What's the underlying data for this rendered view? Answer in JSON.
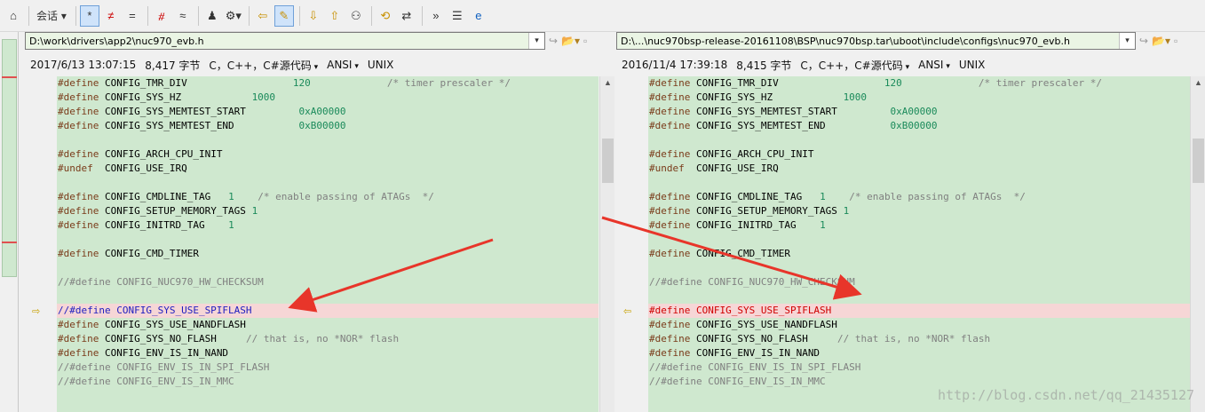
{
  "toolbar": {
    "session_label": "会话",
    "buttons": [
      "home-icon",
      "session-menu",
      "show-all-icon",
      "not-equal-icon",
      "equal-icon",
      "diff-icon",
      "approx-icon",
      "person-icon",
      "rules-icon",
      "prev-arrow-icon",
      "edit-icon",
      "down-arrow-icon",
      "up-arrow-icon",
      "binoculars-icon",
      "swap-icon",
      "refresh-icon",
      "ignore-icon",
      "list-icon",
      "ie-icon"
    ]
  },
  "left": {
    "path": "D:\\work\\drivers\\app2\\nuc970_evb.h",
    "info": {
      "date": "2017/6/13 13:07:15",
      "size": "8,417 字节",
      "lang": "C，C++，C#源代码",
      "encoding": "ANSI",
      "eol": "UNIX"
    },
    "lines": [
      {
        "kw": "#define",
        "id": "CONFIG_TMR_DIV",
        "pad1": "                 ",
        "val": "120",
        "pad2": "            ",
        "cm": "/* timer prescaler */"
      },
      {
        "kw": "#define",
        "id": "CONFIG_SYS_HZ",
        "pad1": "           ",
        "val": "1000",
        "pad2": "",
        "cm": ""
      },
      {
        "kw": "#define",
        "id": "CONFIG_SYS_MEMTEST_START",
        "pad1": "        ",
        "val": "0xA00000",
        "pad2": "",
        "cm": ""
      },
      {
        "kw": "#define",
        "id": "CONFIG_SYS_MEMTEST_END",
        "pad1": "          ",
        "val": "0xB00000",
        "pad2": "",
        "cm": ""
      },
      {
        "kw": "",
        "id": "",
        "pad1": "",
        "val": "",
        "pad2": "",
        "cm": ""
      },
      {
        "kw": "#define",
        "id": "CONFIG_ARCH_CPU_INIT",
        "pad1": "",
        "val": "",
        "pad2": "",
        "cm": ""
      },
      {
        "kw": "#undef ",
        "id": "CONFIG_USE_IRQ",
        "pad1": "",
        "val": "",
        "pad2": "",
        "cm": ""
      },
      {
        "kw": "",
        "id": "",
        "pad1": "",
        "val": "",
        "pad2": "",
        "cm": ""
      },
      {
        "kw": "#define",
        "id": "CONFIG_CMDLINE_TAG",
        "pad1": "  ",
        "val": "1",
        "pad2": "   ",
        "cm": "/* enable passing of ATAGs  */"
      },
      {
        "kw": "#define",
        "id": "CONFIG_SETUP_MEMORY_TAGS",
        "pad1": "",
        "val": "1",
        "pad2": "",
        "cm": ""
      },
      {
        "kw": "#define",
        "id": "CONFIG_INITRD_TAG",
        "pad1": "   ",
        "val": "1",
        "pad2": "",
        "cm": ""
      },
      {
        "kw": "",
        "id": "",
        "pad1": "",
        "val": "",
        "pad2": "",
        "cm": ""
      },
      {
        "kw": "#define",
        "id": "CONFIG_CMD_TIMER",
        "pad1": "",
        "val": "",
        "pad2": "",
        "cm": ""
      },
      {
        "kw": "",
        "id": "",
        "pad1": "",
        "val": "",
        "pad2": "",
        "cm": ""
      },
      {
        "kw": "",
        "id": "",
        "pad1": "",
        "val": "",
        "pad2": "",
        "cm": "//#define CONFIG_NUC970_HW_CHECKSUM"
      },
      {
        "kw": "",
        "id": "",
        "pad1": "",
        "val": "",
        "pad2": "",
        "cm": ""
      },
      {
        "kw": "",
        "id": "",
        "pad1": "",
        "val": "",
        "pad2": "",
        "cm": "//#define CONFIG_SYS_USE_SPIFLASH",
        "hl": true,
        "blue": true
      },
      {
        "kw": "#define",
        "id": "CONFIG_SYS_USE_NANDFLASH",
        "pad1": "",
        "val": "",
        "pad2": "",
        "cm": ""
      },
      {
        "kw": "#define",
        "id": "CONFIG_SYS_NO_FLASH",
        "pad1": "    ",
        "val": "",
        "pad2": "",
        "cm": "// that is, no *NOR* flash"
      },
      {
        "kw": "#define",
        "id": "CONFIG_ENV_IS_IN_NAND",
        "pad1": "",
        "val": "",
        "pad2": "",
        "cm": ""
      },
      {
        "kw": "",
        "id": "",
        "pad1": "",
        "val": "",
        "pad2": "",
        "cm": "//#define CONFIG_ENV_IS_IN_SPI_FLASH"
      },
      {
        "kw": "",
        "id": "",
        "pad1": "",
        "val": "",
        "pad2": "",
        "cm": "//#define CONFIG_ENV_IS_IN_MMC"
      }
    ]
  },
  "right": {
    "path": "D:\\...\\nuc970bsp-release-20161108\\BSP\\nuc970bsp.tar\\uboot\\include\\configs\\nuc970_evb.h",
    "info": {
      "date": "2016/11/4 17:39:18",
      "size": "8,415 字节",
      "lang": "C，C++，C#源代码",
      "encoding": "ANSI",
      "eol": "UNIX"
    },
    "lines": [
      {
        "kw": "#define",
        "id": "CONFIG_TMR_DIV",
        "pad1": "                 ",
        "val": "120",
        "pad2": "            ",
        "cm": "/* timer prescaler */"
      },
      {
        "kw": "#define",
        "id": "CONFIG_SYS_HZ",
        "pad1": "           ",
        "val": "1000",
        "pad2": "",
        "cm": ""
      },
      {
        "kw": "#define",
        "id": "CONFIG_SYS_MEMTEST_START",
        "pad1": "        ",
        "val": "0xA00000",
        "pad2": "",
        "cm": ""
      },
      {
        "kw": "#define",
        "id": "CONFIG_SYS_MEMTEST_END",
        "pad1": "          ",
        "val": "0xB00000",
        "pad2": "",
        "cm": ""
      },
      {
        "kw": "",
        "id": "",
        "pad1": "",
        "val": "",
        "pad2": "",
        "cm": ""
      },
      {
        "kw": "#define",
        "id": "CONFIG_ARCH_CPU_INIT",
        "pad1": "",
        "val": "",
        "pad2": "",
        "cm": ""
      },
      {
        "kw": "#undef ",
        "id": "CONFIG_USE_IRQ",
        "pad1": "",
        "val": "",
        "pad2": "",
        "cm": ""
      },
      {
        "kw": "",
        "id": "",
        "pad1": "",
        "val": "",
        "pad2": "",
        "cm": ""
      },
      {
        "kw": "#define",
        "id": "CONFIG_CMDLINE_TAG",
        "pad1": "  ",
        "val": "1",
        "pad2": "   ",
        "cm": "/* enable passing of ATAGs  */"
      },
      {
        "kw": "#define",
        "id": "CONFIG_SETUP_MEMORY_TAGS",
        "pad1": "",
        "val": "1",
        "pad2": "",
        "cm": ""
      },
      {
        "kw": "#define",
        "id": "CONFIG_INITRD_TAG",
        "pad1": "   ",
        "val": "1",
        "pad2": "",
        "cm": ""
      },
      {
        "kw": "",
        "id": "",
        "pad1": "",
        "val": "",
        "pad2": "",
        "cm": ""
      },
      {
        "kw": "#define",
        "id": "CONFIG_CMD_TIMER",
        "pad1": "",
        "val": "",
        "pad2": "",
        "cm": ""
      },
      {
        "kw": "",
        "id": "",
        "pad1": "",
        "val": "",
        "pad2": "",
        "cm": ""
      },
      {
        "kw": "",
        "id": "",
        "pad1": "",
        "val": "",
        "pad2": "",
        "cm": "//#define CONFIG_NUC970_HW_CHECKSUM"
      },
      {
        "kw": "",
        "id": "",
        "pad1": "",
        "val": "",
        "pad2": "",
        "cm": ""
      },
      {
        "kw": "#define",
        "id": "CONFIG_SYS_USE_SPIFLASH",
        "pad1": "",
        "val": "",
        "pad2": "",
        "cm": "",
        "hl": true,
        "red": true
      },
      {
        "kw": "#define",
        "id": "CONFIG_SYS_USE_NANDFLASH",
        "pad1": "",
        "val": "",
        "pad2": "",
        "cm": ""
      },
      {
        "kw": "#define",
        "id": "CONFIG_SYS_NO_FLASH",
        "pad1": "    ",
        "val": "",
        "pad2": "",
        "cm": "// that is, no *NOR* flash"
      },
      {
        "kw": "#define",
        "id": "CONFIG_ENV_IS_IN_NAND",
        "pad1": "",
        "val": "",
        "pad2": "",
        "cm": ""
      },
      {
        "kw": "",
        "id": "",
        "pad1": "",
        "val": "",
        "pad2": "",
        "cm": "//#define CONFIG_ENV_IS_IN_SPI_FLASH"
      },
      {
        "kw": "",
        "id": "",
        "pad1": "",
        "val": "",
        "pad2": "",
        "cm": "//#define CONFIG_ENV_IS_IN_MMC"
      }
    ]
  },
  "watermark": "http://blog.csdn.net/qq_21435127",
  "colors": {
    "code_bg": "#cfe8cf",
    "highlight": "#f6d6d6",
    "annotation_arrow": "#e8352a"
  }
}
